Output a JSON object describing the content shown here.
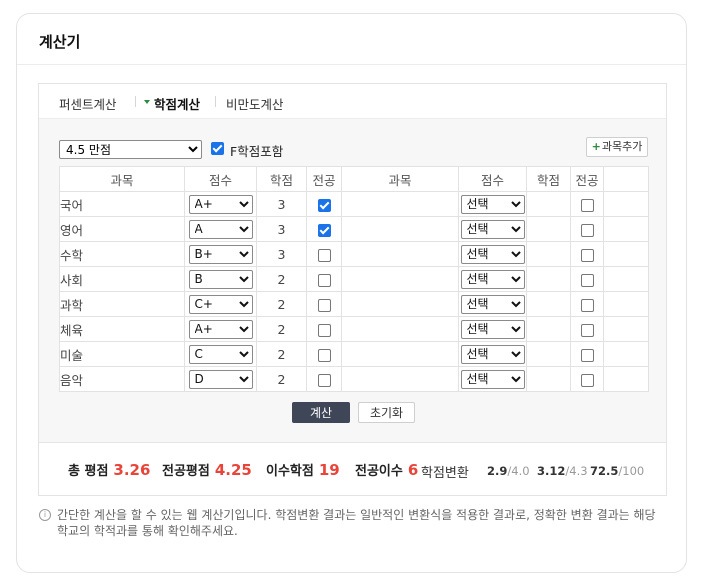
{
  "card": {
    "title": "계산기"
  },
  "tabs": [
    {
      "label": "퍼센트계산",
      "active": false
    },
    {
      "label": "학점계산",
      "active": true
    },
    {
      "label": "비만도계산",
      "active": false
    }
  ],
  "controls": {
    "scale": "4.5 만점",
    "include_f_label": "F학점포함",
    "include_f_checked": true,
    "add_subject_label": "과목추가"
  },
  "table": {
    "headers": [
      "과목",
      "점수",
      "학점",
      "전공",
      "과목",
      "점수",
      "학점",
      "전공"
    ],
    "left_rows": [
      {
        "subject": "국어",
        "grade": "A+",
        "credit": "3",
        "major": true
      },
      {
        "subject": "영어",
        "grade": "A",
        "credit": "3",
        "major": true
      },
      {
        "subject": "수학",
        "grade": "B+",
        "credit": "3",
        "major": false
      },
      {
        "subject": "사회",
        "grade": "B",
        "credit": "2",
        "major": false
      },
      {
        "subject": "과학",
        "grade": "C+",
        "credit": "2",
        "major": false
      },
      {
        "subject": "체육",
        "grade": "A+",
        "credit": "2",
        "major": false
      },
      {
        "subject": "미술",
        "grade": "C",
        "credit": "2",
        "major": false
      },
      {
        "subject": "음악",
        "grade": "D",
        "credit": "2",
        "major": false
      }
    ],
    "right_placeholder": "선택"
  },
  "buttons": {
    "calculate": "계산",
    "reset": "초기화"
  },
  "results": {
    "total_gpa_label": "총 평점",
    "total_gpa": "3.26",
    "major_gpa_label": "전공평점",
    "major_gpa": "4.25",
    "credits_label": "이수학점",
    "credits": "19",
    "major_credits_label": "전공이수",
    "major_credits": "6",
    "conversion_label": "학점변환",
    "conversions": [
      {
        "value": "2.9",
        "max": "/4.0"
      },
      {
        "value": "3.12",
        "max": "/4.3"
      },
      {
        "value": "72.5",
        "max": "/100"
      }
    ]
  },
  "notice": {
    "line1": "간단한 계산을 할 수 있는 웹 계산기입니다. 학점변환 결과는 일반적인 변환식을 적용한 결과로, 정확한 변환 결과는 해당",
    "line2": "학교의 학적과를 통해 확인해주세요."
  }
}
